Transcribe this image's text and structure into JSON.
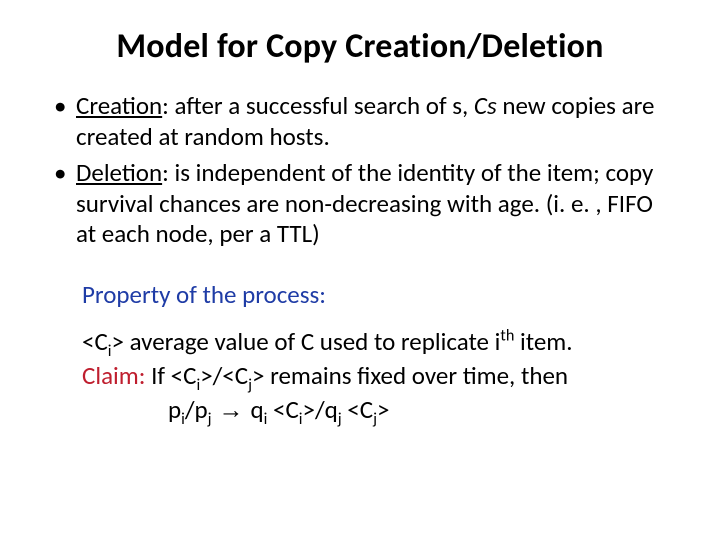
{
  "title": "Model for Copy Creation/Deletion",
  "bullets": {
    "creation": {
      "head": "Creation",
      "rest_a": ": after a successful search of s, ",
      "cs": "Cs",
      "rest_b": " new copies are created at random hosts."
    },
    "deletion": {
      "head": "Deletion",
      "rest": ": is independent of the identity of the item; copy survival chances are non-decreasing with age. (i. e. , FIFO at each node, per a TTL)"
    }
  },
  "property_label": "Property of the process:",
  "avg_line": {
    "open": "<C",
    "i_sub": "i",
    "close": ">",
    "mid": "  average value of C used to replicate i",
    "th": "th",
    "end": " item."
  },
  "claim": {
    "label": "Claim:",
    "p1": " If <C",
    "i1": "i",
    "p2": ">/<C",
    "j1": "j",
    "p3": "> remains fixed over time, then",
    "line2_a": "p",
    "li2_i1": "i",
    "line2_b": "/p",
    "li2_j1": "j",
    "arrow": " → ",
    "line2_c": "q",
    "li2_i2": "i",
    "line2_d": " <C",
    "li2_i3": "i",
    "line2_e": ">/q",
    "li2_j2": "j",
    "line2_f": " <C",
    "li2_j3": "j",
    "line2_g": ">"
  }
}
